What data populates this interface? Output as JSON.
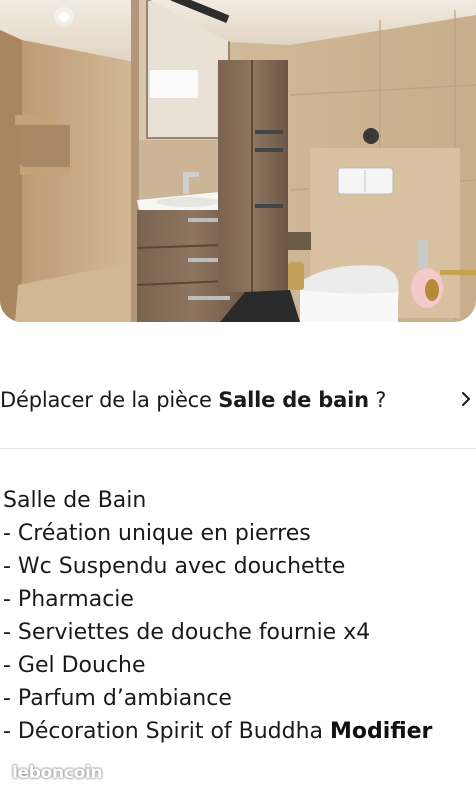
{
  "photo": {
    "alt": "bathroom photo"
  },
  "move_room": {
    "prefix": "Déplacer de la pièce ",
    "room": "Salle de bain",
    "suffix": " ?"
  },
  "description": {
    "lines": [
      "Salle de Bain",
      "- Création unique en pierres",
      "- Wc Suspendu  avec douchette",
      "- Pharmacie",
      "- Serviettes de douche fournie x4",
      "- Gel Douche",
      "- Parfum d’ambiance",
      "- Décoration Spirit of Buddha "
    ],
    "edit_label": "Modifier"
  },
  "watermark": "leboncoin",
  "icons": {
    "chevron": "chevron-right-icon"
  }
}
